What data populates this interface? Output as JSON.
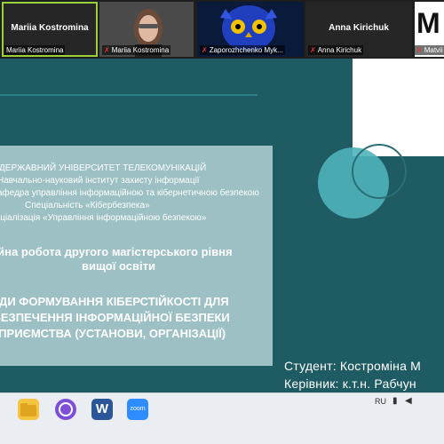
{
  "participants": [
    {
      "big_name": "Mariia  Kostromina",
      "caption": "Mariia Kostromina",
      "muted": false,
      "active": true
    },
    {
      "big_name": "",
      "caption": "Mariia Kostromina",
      "muted": true,
      "active": false
    },
    {
      "big_name": "",
      "caption": "Zaporozhchenko Myk...",
      "muted": true,
      "active": false
    },
    {
      "big_name": "Anna Kirichuk",
      "caption": "Anna Kirichuk",
      "muted": true,
      "active": false
    },
    {
      "big_name": "M",
      "caption": "Matvii Yush",
      "muted": true,
      "active": false
    }
  ],
  "mic_muted_icon": "✗",
  "slide": {
    "title_lines": [
      "ДЕРЖАВНИЙ УНІВЕРСИТЕТ ТЕЛЕКОМУНІКАЦІЙ",
      "Навчально-науковий інститут захисту інформації",
      "Кафедра управління інформаційною та кібернетичною безпекою",
      "Спеціальність «Кібербезпека»",
      "Спеціалізація «Управління інформаційною безпекою»",
      "Кваліфікаційна робота другого магістерського рівня",
      "вищої освіти",
      "МЕТОДИ ФОРМУВАННЯ КІБЕРСТІЙКОСТІ ДЛЯ",
      "ЗАБЕЗПЕЧЕННЯ ІНФОРМАЦІЙНОЇ БЕЗПЕКИ",
      "ПІДПРИЄМСТВА (УСТАНОВИ, ОРГАНІЗАЦІЇ)"
    ],
    "student_label": "Студент: Костроміна М",
    "supervisor_label": "Керівник: к.т.н. Рабчун"
  },
  "taskbar": {
    "icons": [
      "file-explorer-icon",
      "viber-icon",
      "word-icon",
      "zoom-icon"
    ],
    "zoom_label": "zoom",
    "word_label": "W",
    "tray_lang": "RU"
  }
}
